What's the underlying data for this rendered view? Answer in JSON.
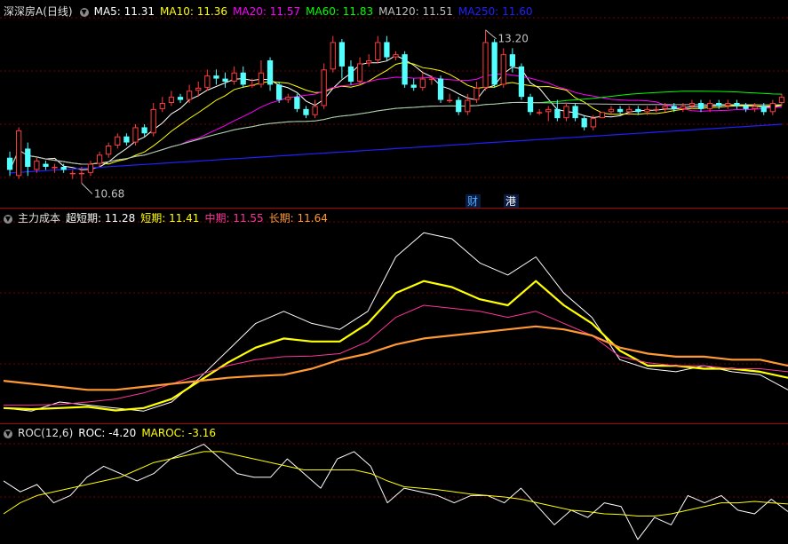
{
  "main_panel": {
    "stock_name": "深深房A",
    "period": "(日线)",
    "indicators": [
      {
        "label": "MA5: 11.31",
        "color": "#ffffff"
      },
      {
        "label": "MA10: 11.36",
        "color": "#ffff00"
      },
      {
        "label": "MA20: 11.57",
        "color": "#ff00ff"
      },
      {
        "label": "MA60: 11.83",
        "color": "#00ff00"
      },
      {
        "label": "MA120: 11.51",
        "color": "#c0c0c0"
      },
      {
        "label": "MA250: 11.60",
        "color": "#2020ff"
      }
    ],
    "high_marker": "13.20",
    "low_marker": "10.68",
    "badges": [
      {
        "text": "财",
        "color": "#4fb0ff"
      },
      {
        "text": "港",
        "color": "#ffffff"
      }
    ]
  },
  "cost_panel": {
    "title": "主力成本",
    "indicators": [
      {
        "label": "超短期: 11.28",
        "color": "#ffffff"
      },
      {
        "label": "短期: 11.41",
        "color": "#ffff00"
      },
      {
        "label": "中期: 11.55",
        "color": "#ff3399"
      },
      {
        "label": "长期: 11.64",
        "color": "#ff9933"
      }
    ]
  },
  "roc_panel": {
    "title": "ROC(12,6)",
    "indicators": [
      {
        "label": "ROC: -4.20",
        "color": "#ffffff"
      },
      {
        "label": "MAROC: -3.16",
        "color": "#ffff00"
      }
    ]
  },
  "colors": {
    "up": "#ff3c3c",
    "down": "#54ffff",
    "grid": "#7a0000",
    "separator": "#b00000"
  },
  "chart_data": [
    {
      "type": "candlestick",
      "candles": [
        [
          11.1,
          10.9,
          11.2,
          10.8
        ],
        [
          10.8,
          11.55,
          11.6,
          10.75
        ],
        [
          11.25,
          10.95,
          11.35,
          10.8
        ],
        [
          10.9,
          11.05,
          11.1,
          10.85
        ],
        [
          11.0,
          10.95,
          11.05,
          10.9
        ],
        [
          10.95,
          10.95,
          11.0,
          10.85
        ],
        [
          10.95,
          10.9,
          11.0,
          10.85
        ],
        [
          10.85,
          10.85,
          10.9,
          10.75
        ],
        [
          10.85,
          10.85,
          10.95,
          10.68
        ],
        [
          10.85,
          11.0,
          11.05,
          10.8
        ],
        [
          11.0,
          11.15,
          11.2,
          10.95
        ],
        [
          11.15,
          11.3,
          11.35,
          11.1
        ],
        [
          11.3,
          11.45,
          11.5,
          11.25
        ],
        [
          11.45,
          11.35,
          11.5,
          11.3
        ],
        [
          11.35,
          11.6,
          11.65,
          11.3
        ],
        [
          11.6,
          11.5,
          11.65,
          11.45
        ],
        [
          11.5,
          11.9,
          12.0,
          11.45
        ],
        [
          11.9,
          12.0,
          12.1,
          11.85
        ],
        [
          12.0,
          12.1,
          12.2,
          11.95
        ],
        [
          12.1,
          12.05,
          12.15,
          12.0
        ],
        [
          12.05,
          12.2,
          12.3,
          12.0
        ],
        [
          12.2,
          12.25,
          12.35,
          12.1
        ],
        [
          12.25,
          12.45,
          12.55,
          12.2
        ],
        [
          12.45,
          12.4,
          12.55,
          12.3
        ],
        [
          12.4,
          12.35,
          12.5,
          12.25
        ],
        [
          12.35,
          12.5,
          12.6,
          12.3
        ],
        [
          12.5,
          12.3,
          12.6,
          12.25
        ],
        [
          12.3,
          12.3,
          12.4,
          12.25
        ],
        [
          12.3,
          12.5,
          12.7,
          12.25
        ],
        [
          12.7,
          12.3,
          12.75,
          12.2
        ],
        [
          12.3,
          12.05,
          12.35,
          12.0
        ],
        [
          12.05,
          12.1,
          12.15,
          12.0
        ],
        [
          12.1,
          11.9,
          12.15,
          11.85
        ],
        [
          11.9,
          11.8,
          11.95,
          11.75
        ],
        [
          11.8,
          11.95,
          12.05,
          11.75
        ],
        [
          11.95,
          12.55,
          12.65,
          11.9
        ],
        [
          12.55,
          13.0,
          13.1,
          12.5
        ],
        [
          13.0,
          12.6,
          13.05,
          12.4
        ],
        [
          12.6,
          12.35,
          12.7,
          12.3
        ],
        [
          12.35,
          12.65,
          12.75,
          12.3
        ],
        [
          12.65,
          12.7,
          12.8,
          12.6
        ],
        [
          12.7,
          13.0,
          13.1,
          12.65
        ],
        [
          13.0,
          12.75,
          13.1,
          12.7
        ],
        [
          12.75,
          12.8,
          12.85,
          12.7
        ],
        [
          12.8,
          12.3,
          12.85,
          12.25
        ],
        [
          12.3,
          12.25,
          12.4,
          12.2
        ],
        [
          12.25,
          12.4,
          12.5,
          12.2
        ],
        [
          12.4,
          12.4,
          12.45,
          12.3
        ],
        [
          12.4,
          12.05,
          12.45,
          12.0
        ],
        [
          12.05,
          12.05,
          12.15,
          12.0
        ],
        [
          12.05,
          11.85,
          12.1,
          11.8
        ],
        [
          11.85,
          12.05,
          12.15,
          11.8
        ],
        [
          12.05,
          12.25,
          12.35,
          12.0
        ],
        [
          12.25,
          13.0,
          13.2,
          12.2
        ],
        [
          13.0,
          12.3,
          13.05,
          12.25
        ],
        [
          12.3,
          12.8,
          12.9,
          12.25
        ],
        [
          12.8,
          12.6,
          12.9,
          12.5
        ],
        [
          12.6,
          12.1,
          12.65,
          12.05
        ],
        [
          12.1,
          11.85,
          12.15,
          11.8
        ],
        [
          11.85,
          11.85,
          11.9,
          11.8
        ],
        [
          11.85,
          11.9,
          11.95,
          11.7
        ],
        [
          11.9,
          11.75,
          12.05,
          11.7
        ],
        [
          11.75,
          11.95,
          12.0,
          11.7
        ],
        [
          11.95,
          11.75,
          12.0,
          11.7
        ],
        [
          11.75,
          11.6,
          11.8,
          11.55
        ],
        [
          11.6,
          11.75,
          11.8,
          11.55
        ],
        [
          11.75,
          11.85,
          11.85,
          11.75
        ],
        [
          11.85,
          11.9,
          11.95,
          11.8
        ],
        [
          11.9,
          11.85,
          11.95,
          11.8
        ],
        [
          11.85,
          11.9,
          11.95,
          11.8
        ],
        [
          11.9,
          11.85,
          11.95,
          11.8
        ],
        [
          11.85,
          11.9,
          11.95,
          11.8
        ],
        [
          11.9,
          11.9,
          11.95,
          11.85
        ],
        [
          11.9,
          11.95,
          12.0,
          11.85
        ],
        [
          11.95,
          11.9,
          12.0,
          11.85
        ],
        [
          11.9,
          11.95,
          12.0,
          11.85
        ],
        [
          11.95,
          12.0,
          12.05,
          11.9
        ],
        [
          12.0,
          11.9,
          12.05,
          11.85
        ],
        [
          11.9,
          12.0,
          12.05,
          11.85
        ],
        [
          12.0,
          11.95,
          12.05,
          11.9
        ],
        [
          11.95,
          12.0,
          12.05,
          11.9
        ],
        [
          12.0,
          11.95,
          12.05,
          11.9
        ],
        [
          11.95,
          11.9,
          12.0,
          11.85
        ],
        [
          11.9,
          11.95,
          12.0,
          11.85
        ],
        [
          11.95,
          11.85,
          12.0,
          11.8
        ],
        [
          11.85,
          12.0,
          12.05,
          11.8
        ],
        [
          12.0,
          12.1,
          12.15,
          11.95
        ]
      ]
    },
    {
      "type": "line",
      "series": [
        {
          "name": "超短期",
          "values": [
            11.1,
            11.05,
            11.2,
            11.15,
            11.1,
            11.05,
            11.2,
            11.6,
            12.05,
            12.5,
            12.7,
            12.5,
            12.4,
            12.7,
            13.6,
            14.0,
            13.9,
            13.5,
            13.3,
            13.6,
            13.0,
            12.6,
            11.9,
            11.75,
            11.7,
            11.8,
            11.7,
            11.65,
            11.4
          ]
        },
        {
          "name": "短期",
          "values": [
            11.1,
            11.08,
            11.1,
            11.12,
            11.06,
            11.1,
            11.25,
            11.55,
            11.85,
            12.1,
            12.25,
            12.2,
            12.2,
            12.5,
            13.0,
            13.2,
            13.1,
            12.9,
            12.8,
            13.2,
            12.8,
            12.5,
            12.05,
            11.8,
            11.8,
            11.75,
            11.75,
            11.7,
            11.6
          ]
        },
        {
          "name": "中期",
          "values": [
            11.15,
            11.15,
            11.16,
            11.2,
            11.25,
            11.35,
            11.5,
            11.65,
            11.8,
            11.9,
            11.95,
            11.96,
            12.0,
            12.2,
            12.6,
            12.8,
            12.75,
            12.7,
            12.6,
            12.7,
            12.5,
            12.3,
            11.95,
            11.85,
            11.8,
            11.8,
            11.75,
            11.75,
            11.7
          ]
        },
        {
          "name": "长期",
          "values": [
            11.55,
            11.5,
            11.45,
            11.4,
            11.4,
            11.45,
            11.5,
            11.55,
            11.6,
            11.63,
            11.65,
            11.75,
            11.9,
            12.0,
            12.15,
            12.25,
            12.3,
            12.35,
            12.4,
            12.45,
            12.4,
            12.3,
            12.1,
            12.0,
            11.95,
            11.95,
            11.9,
            11.9,
            11.8
          ]
        }
      ]
    },
    {
      "type": "line",
      "series": [
        {
          "name": "ROC",
          "values": [
            0,
            -1.5,
            -0.5,
            -3,
            -2,
            0.5,
            2,
            1,
            0,
            1,
            3,
            4,
            5,
            3,
            1,
            0.5,
            0.5,
            3,
            1,
            -1,
            3,
            4,
            2,
            -3,
            -1,
            -1.5,
            -2,
            -3,
            -2,
            -2,
            -3,
            -1,
            -3.5,
            -6,
            -4,
            -5,
            -3,
            -3.5,
            -8,
            -5,
            -6,
            -2,
            -3,
            -2,
            -4,
            -4.5,
            -2.5,
            -4.2
          ]
        },
        {
          "name": "MAROC",
          "values": [
            -4.5,
            -3,
            -2,
            -1.5,
            -1,
            -0.5,
            0,
            0.5,
            1.5,
            2.5,
            3,
            3.5,
            4,
            4,
            3.5,
            3,
            2.5,
            2,
            1.5,
            1.5,
            1.5,
            1.5,
            1,
            0,
            -0.8,
            -1,
            -1.2,
            -1.5,
            -1.8,
            -2,
            -2.2,
            -2.5,
            -3,
            -3.5,
            -4,
            -4.2,
            -4.5,
            -4.6,
            -4.8,
            -4.8,
            -4.5,
            -4,
            -3.5,
            -3,
            -3,
            -2.8,
            -3,
            -3.16
          ]
        }
      ]
    }
  ]
}
